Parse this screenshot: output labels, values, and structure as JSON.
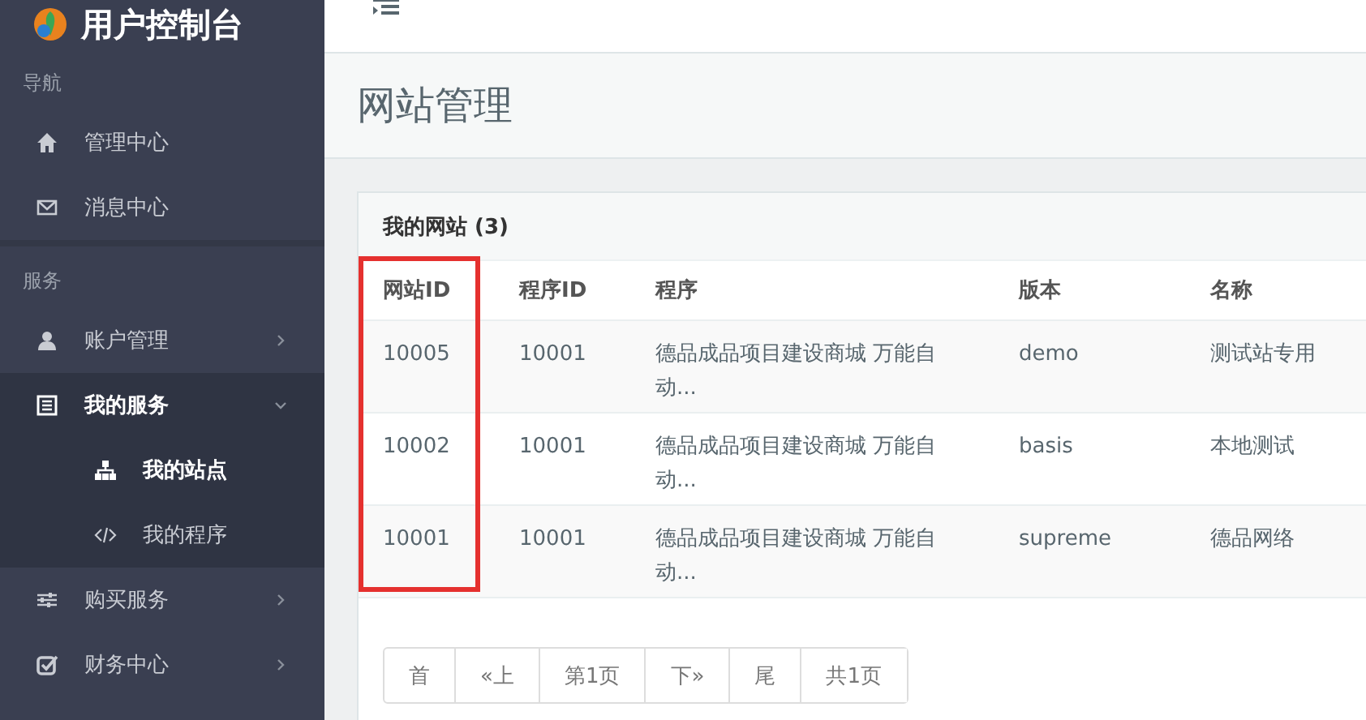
{
  "sidebar": {
    "logo_text": "用户控制台",
    "sections": [
      {
        "title": "导航",
        "items": [
          {
            "label": "管理中心",
            "selected": false
          },
          {
            "label": "消息中心",
            "selected": false
          }
        ]
      },
      {
        "title": "服务",
        "items": [
          {
            "label": "账户管理",
            "selected": false,
            "expanded": false
          },
          {
            "label": "我的服务",
            "selected": false,
            "expanded": true,
            "children": [
              {
                "label": "我的站点",
                "selected": true
              },
              {
                "label": "我的程序",
                "selected": false
              }
            ]
          },
          {
            "label": "购买服务",
            "selected": false,
            "expanded": false
          },
          {
            "label": "财务中心",
            "selected": false,
            "expanded": false
          }
        ]
      }
    ]
  },
  "page_title": "网站管理",
  "card": {
    "title": "我的网站 (3)",
    "table": {
      "columns": [
        "网站ID",
        "程序ID",
        "程序",
        "版本",
        "名称"
      ],
      "rows": [
        [
          "10005",
          "10001",
          "德品成品项目建设商城 万能自动...",
          "demo",
          "测试站专用"
        ],
        [
          "10002",
          "10001",
          "德品成品项目建设商城 万能自动...",
          "basis",
          "本地测试"
        ],
        [
          "10001",
          "10001",
          "德品成品项目建设商城 万能自动...",
          "supreme",
          "德品网络"
        ]
      ]
    },
    "pagination": [
      "首",
      "«上",
      "第1页",
      "下»",
      "尾",
      "共1页"
    ]
  }
}
